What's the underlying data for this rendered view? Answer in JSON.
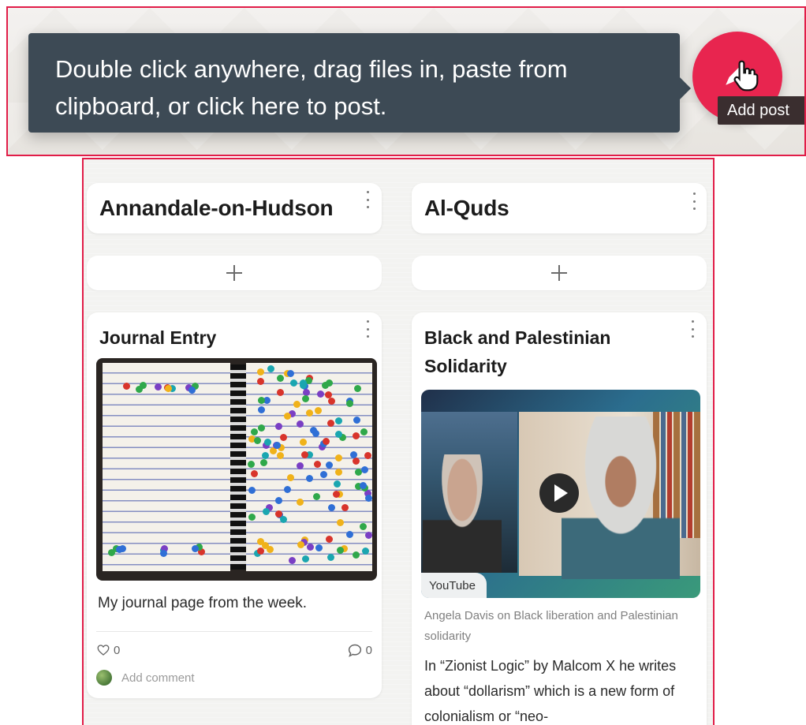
{
  "top": {
    "tooltip_text": "Double click anywhere, drag files in, paste from clipboard, or click here to post.",
    "add_button_tooltip": "Add post",
    "accent_color": "#e8254f",
    "tooltip_bg": "#3d4a55"
  },
  "columns": [
    {
      "title": "Annandale-on-Hudson",
      "add_label": "+",
      "post": {
        "title": "Journal Entry",
        "body": "My journal page from the week.",
        "likes": "0",
        "comments": "0",
        "comment_placeholder": "Add comment"
      }
    },
    {
      "title": "Al-Quds",
      "add_label": "+",
      "post": {
        "title": "Black and Palestinian Solidarity",
        "source_label": "YouTube",
        "link_caption": "Angela Davis on Black liberation and Palestinian solidarity",
        "body": "In “Zionist Logic” by Malcom X he writes about “dollarism” which is a new form of colonialism or “neo-"
      }
    }
  ]
}
